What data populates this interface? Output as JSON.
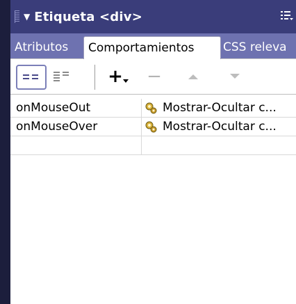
{
  "panel": {
    "title": "Etiqueta <div>",
    "collapse_icon": "triangle-down-icon",
    "menu_icon": "panel-options-icon"
  },
  "tabs": [
    {
      "label": "Atributos",
      "active": false
    },
    {
      "label": "Comportamientos",
      "active": true
    },
    {
      "label": "CSS releva",
      "active": false
    }
  ],
  "toolbar": {
    "buttons": [
      {
        "name": "show-set-events",
        "icon": "list-view-icon",
        "active": true
      },
      {
        "name": "show-all-events",
        "icon": "list-all-icon",
        "active": false
      },
      {
        "name": "add-behavior",
        "icon": "plus-dropdown-icon",
        "label": "+"
      },
      {
        "name": "remove-behavior",
        "icon": "minus-icon",
        "label": "−"
      },
      {
        "name": "move-up",
        "icon": "arrow-up-icon"
      },
      {
        "name": "move-down",
        "icon": "arrow-down-icon"
      }
    ]
  },
  "behaviors": [
    {
      "event": "onMouseOut",
      "action": "Mostrar-Ocultar c..."
    },
    {
      "event": "onMouseOver",
      "action": "Mostrar-Ocultar c..."
    },
    {
      "event": "",
      "action": ""
    }
  ],
  "colors": {
    "titlebar": "#3a3d7a",
    "tabbar": "#6e72b0",
    "background": "#1c1e3c"
  }
}
